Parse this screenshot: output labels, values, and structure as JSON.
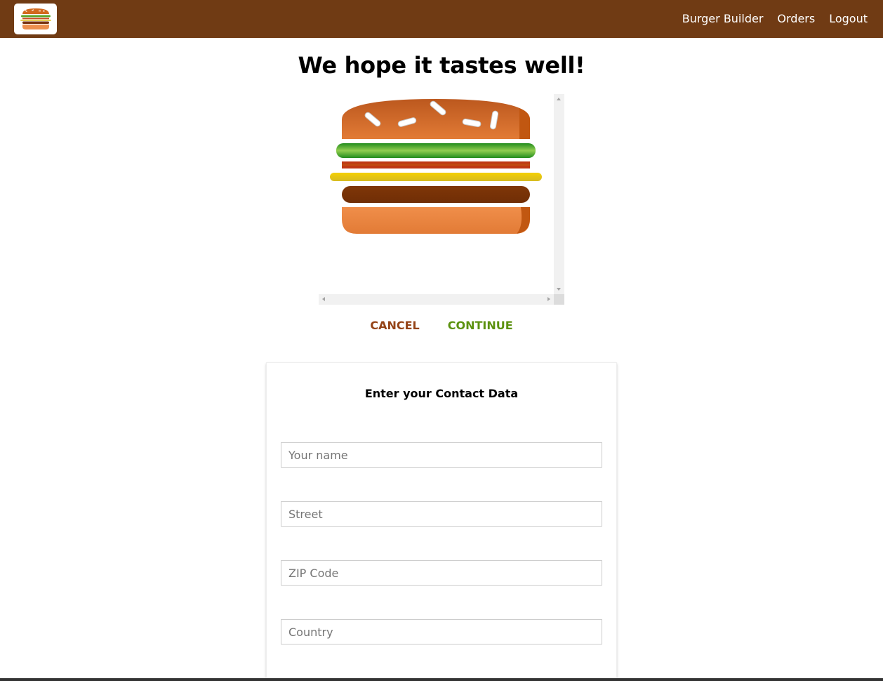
{
  "toolbar": {
    "logo_icon": "burger-logo-icon",
    "background": "#703b14",
    "nav": [
      {
        "label": "Burger Builder"
      },
      {
        "label": "Orders"
      },
      {
        "label": "Logout"
      }
    ]
  },
  "summary": {
    "title": "We hope it tastes well!",
    "cancel_label": "CANCEL",
    "continue_label": "CONTINUE",
    "cancel_color": "#944317",
    "continue_color": "#5c9210"
  },
  "contact": {
    "title": "Enter your Contact Data",
    "fields": [
      {
        "placeholder": "Your name",
        "value": ""
      },
      {
        "placeholder": "Street",
        "value": ""
      },
      {
        "placeholder": "ZIP Code",
        "value": ""
      },
      {
        "placeholder": "Country",
        "value": ""
      }
    ]
  }
}
